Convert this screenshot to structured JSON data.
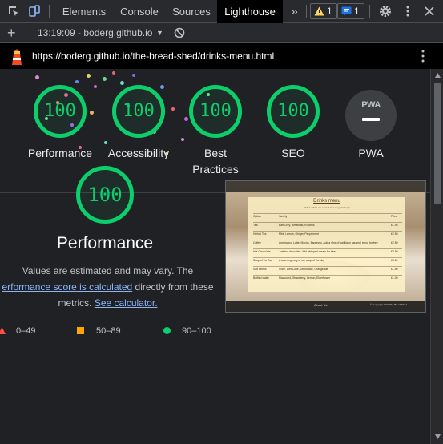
{
  "devtools": {
    "tabs": [
      "Elements",
      "Console",
      "Sources",
      "Lighthouse"
    ],
    "active_tab": "Lighthouse",
    "more": "»",
    "warnings_count": "1",
    "messages_count": "1"
  },
  "toolbar": {
    "add": "+",
    "report_label": "13:19:09 - boderg.github.io",
    "report_caret": "▼"
  },
  "urlbar": {
    "url": "https://boderg.github.io/the-bread-shed/drinks-menu.html"
  },
  "gauges": [
    {
      "score": "100",
      "label": "Performance"
    },
    {
      "score": "100",
      "label": "Accessibility"
    },
    {
      "score": "100",
      "label": "Best",
      "label2": "Practices"
    },
    {
      "score": "100",
      "label": "SEO"
    }
  ],
  "pwa": {
    "badge": "PWA",
    "label": "PWA"
  },
  "performance": {
    "score": "100",
    "title": "Performance",
    "desc1": "Values are estimated and may vary. The",
    "desc_link1": "erformance score is calculated",
    "desc2": " directly from these",
    "desc3": "metrics. ",
    "desc_link2": "See calculator."
  },
  "legend": [
    {
      "range": "0–49",
      "color": "#ff4e42"
    },
    {
      "range": "50–89",
      "color": "#ffa400"
    },
    {
      "range": "90–100",
      "color": "#0cce6b"
    }
  ],
  "thumbnail": {
    "heading": "Drinks menu",
    "subheading": "All hot drinks are served in a mug sized cup",
    "columns": [
      "Option",
      "Variety",
      "Price"
    ],
    "rows": [
      [
        "Tea",
        "Earl Grey, Breakfast, Rooibos",
        "£1.95"
      ],
      [
        "Herbal Tea",
        "Mint, Lemon, Ginger, Peppermint",
        "£2.50"
      ],
      [
        "Coffee",
        "Americano, Latte, Mocha, Espresso, Add a shot of vanilla or caramel syrup for free",
        "£2.50"
      ],
      [
        "Hot Chocolate",
        "Just hot chocolate. Add whipped cream for free",
        "£2.50"
      ],
      [
        "Soup of the Day",
        "A warming mug of our soup of the day",
        "£3.50"
      ],
      [
        "Soft Drinks",
        "Coke, Diet Coke, Lemonade, Orangeade",
        "£1.50"
      ],
      [
        "Bottled water",
        "Flavoured, Strawberry, Lemon, Elderflower",
        "£1.00"
      ]
    ],
    "footer_left": "About Us",
    "footer_right": "© Copyright 2023 The Bread Shed"
  },
  "colors": {
    "pass": "#0cce6b",
    "average": "#ffa400",
    "fail": "#ff4e42",
    "link": "#8ab4f8"
  }
}
